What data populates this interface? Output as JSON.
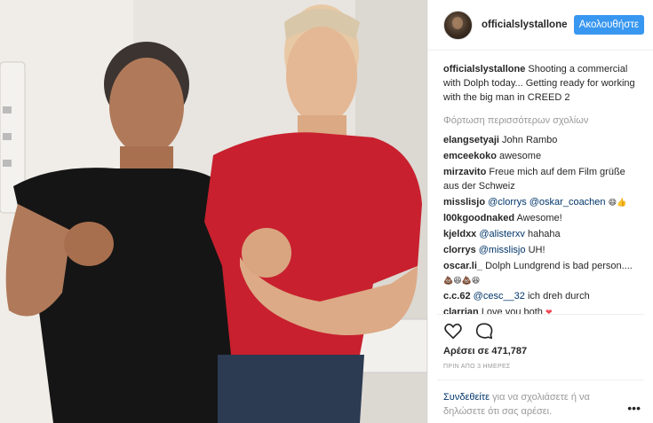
{
  "post": {
    "username": "officialslystallone",
    "follow_label": "Ακολουθήστε",
    "caption_user": "officialslystallone",
    "caption_text": "Shooting a commercial with Dolph today... Getting ready for working with the big man in CREED 2",
    "load_more": "Φόρτωση περισσότερων σχολίων"
  },
  "comments": [
    {
      "user": "elangsetyaji",
      "text": "John Rambo"
    },
    {
      "user": "emceekoko",
      "text": "awesome"
    },
    {
      "user": "mirzavito",
      "text": "Freue mich auf dem Film grüße aus der Schweiz"
    },
    {
      "user": "misslisjo",
      "mention1": "@clorrys",
      "mention2": "@oskar_coachen",
      "emoji": "😄👍"
    },
    {
      "user": "l00kgoodnaked",
      "text": "Awesome!"
    },
    {
      "user": "kjeldxx",
      "mention1": "@alisterxv",
      "text": "hahaha"
    },
    {
      "user": "clorrys",
      "mention1": "@misslisjo",
      "text": "UH!"
    },
    {
      "user": "oscar.li_",
      "text": "Dolph Lundgrend is bad person....",
      "emoji": "💩😆💩😆"
    },
    {
      "user": "c.c.62",
      "mention1": "@cesc__32",
      "text": "ich dreh durch"
    },
    {
      "user": "clarrian",
      "text": "Love you both",
      "emoji": "❤"
    }
  ],
  "stats": {
    "likes": "Αρέσει σε 471,787",
    "time": "ΠΡΙΝ ΑΠΟ 3 ΗΜΕΡΕΣ"
  },
  "login": {
    "link": "Συνδεθείτε",
    "text": " για να σχολιάσετε ή να δηλώσετε ότι σας αρέσει."
  },
  "icons": {
    "heart": "heart-icon",
    "comment": "comment-icon",
    "more": "more-icon"
  },
  "colors": {
    "accent": "#3897f0",
    "mention": "#003569",
    "muted": "#999999"
  }
}
